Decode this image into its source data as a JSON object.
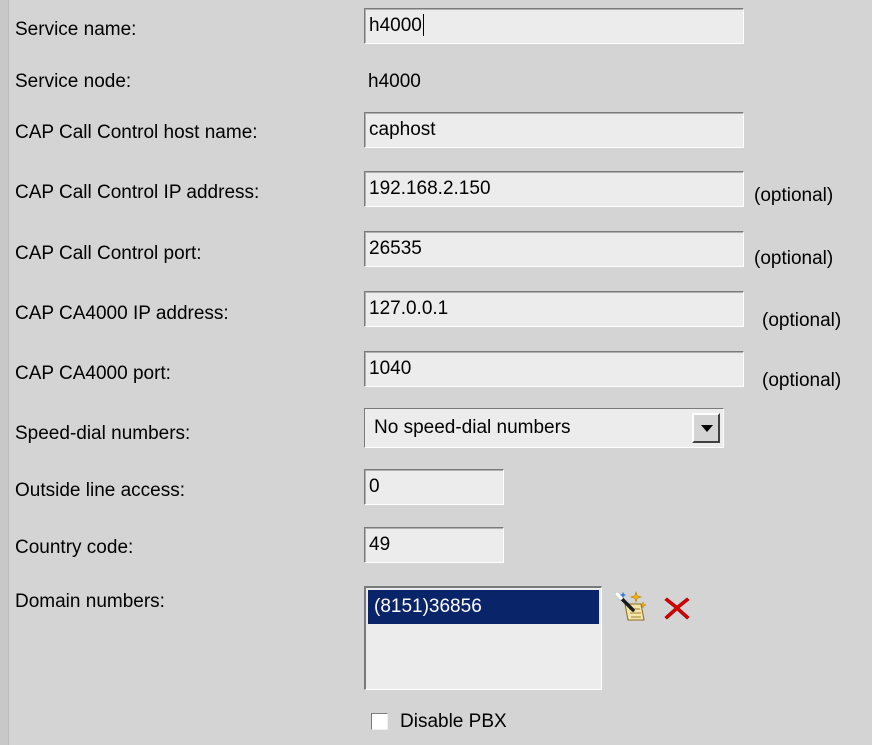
{
  "form": {
    "service_name": {
      "label": "Service name:",
      "value": "h4000"
    },
    "service_node": {
      "label": "Service node:",
      "value": "h4000"
    },
    "cc_host": {
      "label": "CAP Call Control host name:",
      "value": "caphost"
    },
    "cc_ip": {
      "label": "CAP Call Control IP address:",
      "value": "192.168.2.150",
      "note": "(optional)"
    },
    "cc_port": {
      "label": "CAP Call Control port:",
      "value": "26535",
      "note": "(optional)"
    },
    "ca_ip": {
      "label": "CAP CA4000 IP address:",
      "value": "127.0.0.1",
      "note": "(optional)"
    },
    "ca_port": {
      "label": "CAP CA4000 port:",
      "value": "1040",
      "note": "(optional)"
    },
    "speed_dial": {
      "label": "Speed-dial numbers:",
      "selected": "No speed-dial numbers"
    },
    "outside_line": {
      "label": "Outside line access:",
      "value": "0"
    },
    "country_code": {
      "label": "Country code:",
      "value": "49"
    },
    "domain_numbers": {
      "label": "Domain numbers:",
      "items": [
        "(8151)36856"
      ]
    },
    "disable_pbx": {
      "label": "Disable PBX",
      "checked": false
    }
  },
  "icons": {
    "edit": "edit-wand-icon",
    "delete": "delete-x-icon",
    "delete_color": "#e00000"
  }
}
